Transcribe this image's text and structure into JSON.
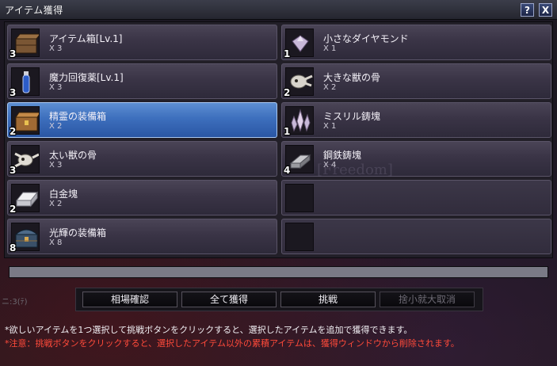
{
  "window": {
    "title": "アイテム獲得",
    "help_label": "?",
    "close_label": "X"
  },
  "items": [
    {
      "name": "アイテム箱[Lv.1]",
      "count": "X 3",
      "qty": "3",
      "icon": "wooden-box-icon"
    },
    {
      "name": "小さなダイヤモンド",
      "count": "X 1",
      "qty": "1",
      "icon": "diamond-icon"
    },
    {
      "name": "魔力回復薬[Lv.1]",
      "count": "X 3",
      "qty": "3",
      "icon": "potion-vial-icon"
    },
    {
      "name": "大きな獣の骨",
      "count": "X 2",
      "qty": "2",
      "icon": "beast-skull-icon"
    },
    {
      "name": "精霊の装備箱",
      "count": "X 2",
      "qty": "2",
      "icon": "equipment-chest-icon",
      "selected": true
    },
    {
      "name": "ミスリル鋳塊",
      "count": "X 1",
      "qty": "1",
      "icon": "mithril-crystal-icon"
    },
    {
      "name": "太い獣の骨",
      "count": "X 3",
      "qty": "3",
      "icon": "bone-icon"
    },
    {
      "name": "鋼鉄鋳塊",
      "count": "X 4",
      "qty": "4",
      "icon": "steel-ingot-icon"
    },
    {
      "name": "白金塊",
      "count": "X 2",
      "qty": "2",
      "icon": "platinum-ingot-icon"
    },
    {
      "name": "",
      "count": "",
      "qty": "",
      "icon": "empty-slot"
    },
    {
      "name": "光輝の装備箱",
      "count": "X 8",
      "qty": "8",
      "icon": "radiant-chest-icon"
    },
    {
      "name": "",
      "count": "",
      "qty": "",
      "icon": "empty-slot"
    }
  ],
  "watermark": "[Freedom]",
  "progress": {
    "fill": 1.0
  },
  "buttons": {
    "market_check": "相場確認",
    "acquire_all": "全て獲得",
    "challenge": "挑戦",
    "cancel_max": "捨小就大取消"
  },
  "side_text": "ニ:3(ﾃ)",
  "notes": {
    "line1": "*欲しいアイテムを1つ選択して挑戦ボタンをクリックすると、選択したアイテムを追加で獲得できます。",
    "line2": "*注意：挑戦ボタンをクリックすると、選択したアイテム以外の累積アイテムは、獲得ウィンドウから削除されます。"
  },
  "colors": {
    "selected_slot": "#3d6fbd",
    "warning_text": "#ff4a3a"
  }
}
